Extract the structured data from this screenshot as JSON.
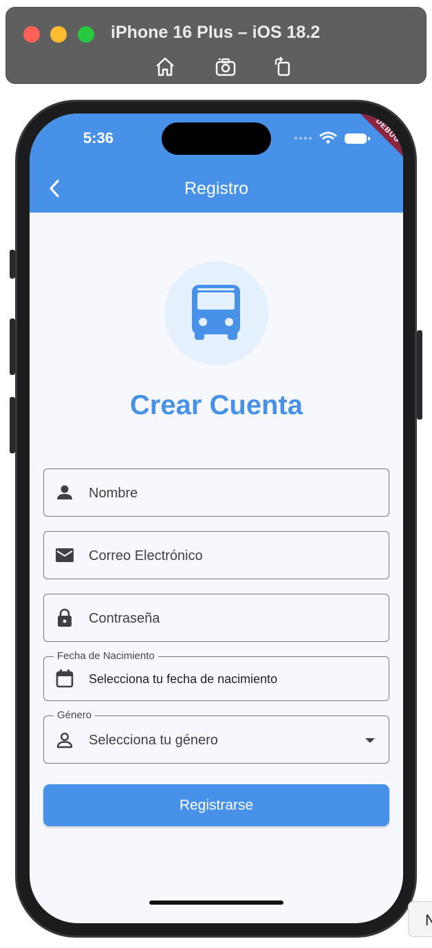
{
  "simulator": {
    "title": "iPhone 16 Plus – iOS 18.2",
    "buttons": [
      "home-icon",
      "screenshot-icon",
      "rotate-icon"
    ]
  },
  "status_bar": {
    "time": "5:36",
    "debug_label": "DEBUG"
  },
  "app_bar": {
    "title": "Registro",
    "back_icon": "chevron-left-icon",
    "color": "#4891e8"
  },
  "header": {
    "logo_icon": "bus-icon",
    "title": "Crear Cuenta"
  },
  "form": {
    "name": {
      "placeholder": "Nombre",
      "icon": "person-icon"
    },
    "email": {
      "placeholder": "Correo Electrónico",
      "icon": "mail-icon"
    },
    "password": {
      "placeholder": "Contraseña",
      "icon": "lock-icon"
    },
    "birthdate": {
      "label": "Fecha de Nacimiento",
      "value": "Selecciona tu fecha de nacimiento",
      "icon": "calendar-icon"
    },
    "gender": {
      "label": "Género",
      "value": "Selecciona tu género",
      "icon": "person-outline-icon"
    },
    "submit_label": "Registrarse"
  },
  "corner_chip": {
    "text": "N"
  },
  "colors": {
    "primary": "#4891e8",
    "background": "#f7f8fd",
    "logo_bg": "#e4f0fb"
  }
}
